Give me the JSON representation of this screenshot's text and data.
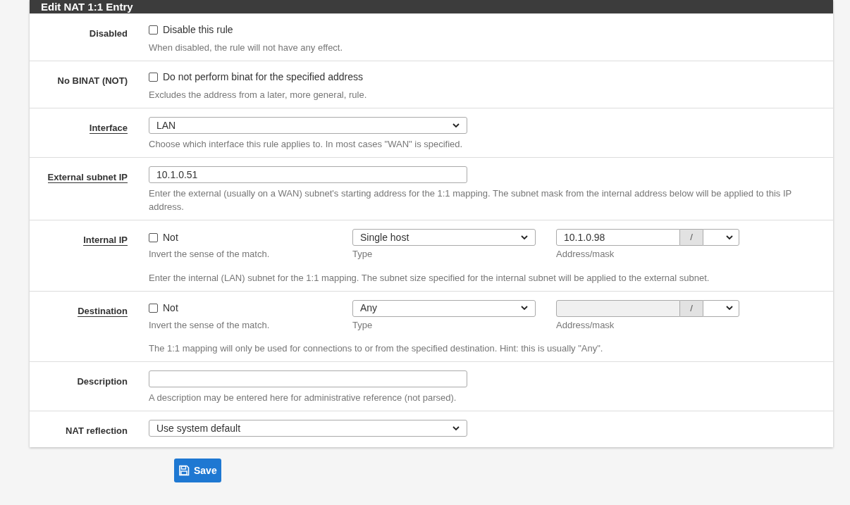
{
  "panel": {
    "title": "Edit NAT 1:1 Entry"
  },
  "rows": [
    {
      "kind": "checkbox",
      "label": "Disabled",
      "linked": false,
      "checkbox": {
        "label": "Disable this rule",
        "checked": false
      },
      "help": "When disabled, the rule will not have any effect."
    },
    {
      "kind": "checkbox",
      "label": "No BINAT (NOT)",
      "linked": false,
      "checkbox": {
        "label": "Do not perform binat for the specified address",
        "checked": false
      },
      "help": "Excludes the address from a later, more general, rule."
    },
    {
      "kind": "select",
      "label": "Interface",
      "linked": true,
      "value": "LAN",
      "help": "Choose which interface this rule applies to. In most cases \"WAN\" is specified."
    },
    {
      "kind": "input",
      "label": "External subnet IP",
      "linked": true,
      "value": "10.1.0.51",
      "help": "Enter the external (usually on a WAN) subnet's starting address for the 1:1 mapping. The subnet mask from the internal address below will be applied to this IP address."
    },
    {
      "kind": "address",
      "label": "Internal IP",
      "linked": true,
      "not": {
        "label": "Not",
        "checked": false,
        "help": "Invert the sense of the match."
      },
      "type": {
        "value": "Single host",
        "label": "Type"
      },
      "address": {
        "value": "10.1.0.98",
        "disabled": false,
        "separator": "/",
        "label": "Address/mask"
      },
      "help": "Enter the internal (LAN) subnet for the 1:1 mapping. The subnet size specified for the internal subnet will be applied to the external subnet."
    },
    {
      "kind": "address",
      "label": "Destination",
      "linked": true,
      "not": {
        "label": "Not",
        "checked": false,
        "help": "Invert the sense of the match."
      },
      "type": {
        "value": "Any",
        "label": "Type"
      },
      "address": {
        "disabled": true,
        "separator": "/",
        "label": "Address/mask"
      },
      "help": "The 1:1 mapping will only be used for connections to or from the specified destination. Hint: this is usually \"Any\"."
    },
    {
      "kind": "input",
      "label": "Description",
      "linked": false,
      "help": "A description may be entered here for administrative reference (not parsed)."
    },
    {
      "kind": "select",
      "label": "NAT reflection",
      "linked": false,
      "value": "Use system default"
    }
  ],
  "save_button": {
    "label": "Save"
  }
}
